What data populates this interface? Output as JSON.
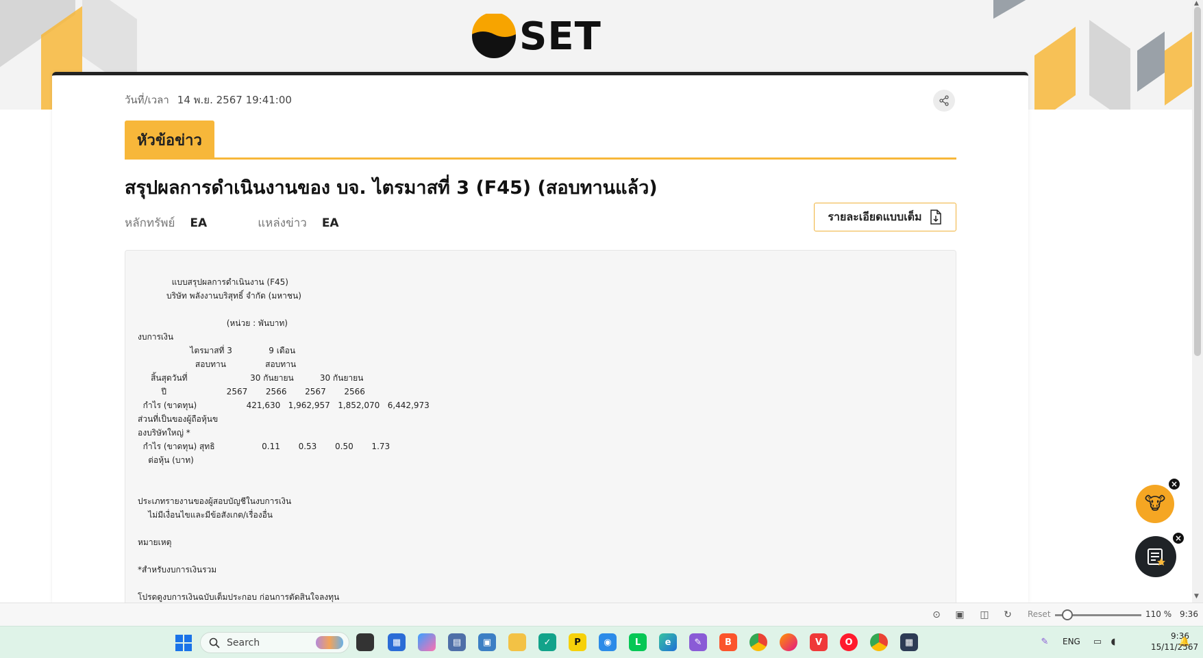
{
  "logo": {
    "text": "SET"
  },
  "article": {
    "datetime_label": "วันที่/เวลา",
    "datetime_value": "14 พ.ย. 2567 19:41:00",
    "section_tab": "หัวข้อข่าว",
    "headline": "สรุปผลการดำเนินงานของ บจ. ไตรมาสที่ 3 (F45) (สอบทานแล้ว)",
    "security_label": "หลักทรัพย์",
    "security_value": "EA",
    "source_label": "แหล่งข่าว",
    "source_value": "EA",
    "full_detail_button": "รายละเอียดแบบเต็ม",
    "body_text": "             แบบสรุปผลการดำเนินงาน (F45)\n           บริษัท พลังงานบริสุทธิ์ จำกัด (มหาชน)\n\n                                  (หน่วย : พันบาท)\nงบการเงิน\n                    ไตรมาสที่ 3              9 เดือน\n                      สอบทาน               สอบทาน\n     สิ้นสุดวันที่                        30 กันยายน          30 กันยายน\n         ปี                       2567       2566       2567       2566\n  กำไร (ขาดทุน)                   421,630   1,962,957   1,852,070   6,442,973\nส่วนที่เป็นของผู้ถือหุ้นข\nองบริษัทใหญ่ *\n  กำไร (ขาดทุน) สุทธิ                  0.11       0.53       0.50       1.73\n    ต่อหุ้น (บาท)\n\n\nประเภทรายงานของผู้สอบบัญชีในงบการเงิน\n    ไม่มีเงื่อนไขและมีข้อสังเกต/เรื่องอื่น\n\nหมายเหตุ\n\n*สำหรับงบการเงินรวม\n\nโปรดดูงบการเงินฉบับเต็มประกอบ ก่อนการตัดสินใจลงทุน"
  },
  "browser_status": {
    "reset_label": "Reset",
    "zoom": "110 %",
    "time": "9:36"
  },
  "taskbar": {
    "search_placeholder": "Search",
    "language": "ENG",
    "clock_time": "9:36",
    "clock_date": "15/11/2567"
  },
  "colors": {
    "accent": "#f7b73a",
    "taskbar": "#dff3e8"
  }
}
